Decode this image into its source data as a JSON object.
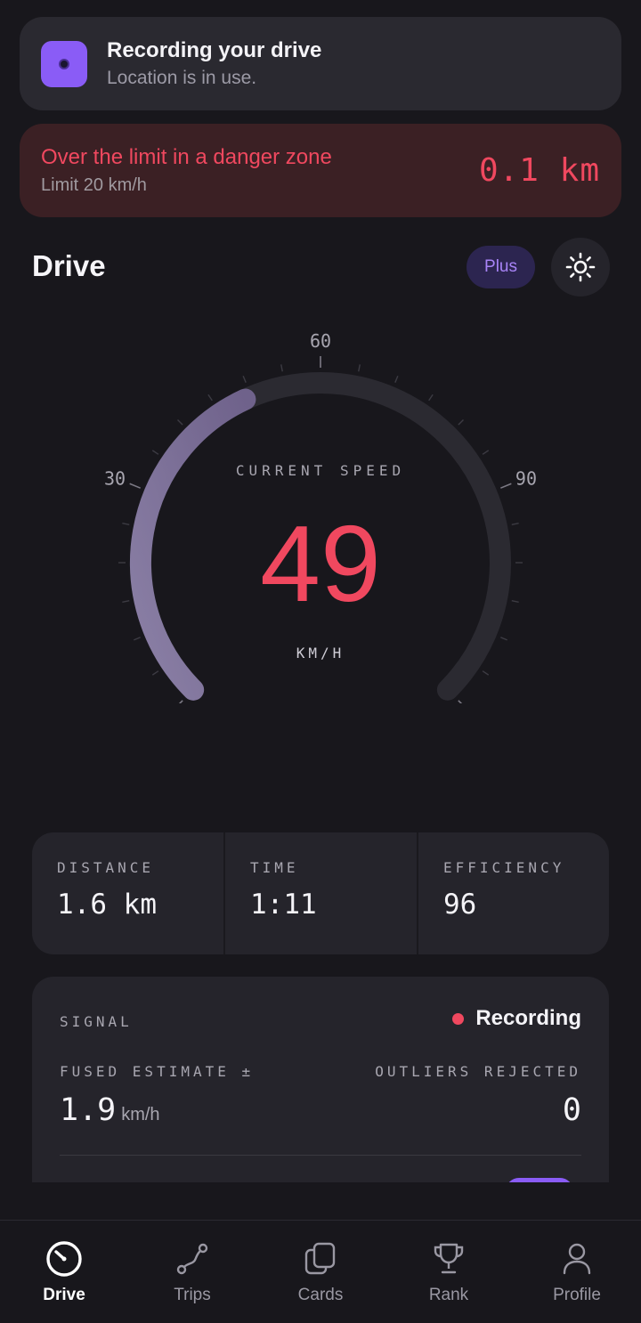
{
  "notification": {
    "title": "Recording your drive",
    "subtitle": "Location is in use.",
    "icon": "record-dot-icon",
    "accent": "#8a5cf6"
  },
  "alert": {
    "title": "Over the limit in a danger zone",
    "subtitle": "Limit 20 km/h",
    "distance": "0.1 km",
    "color": "#f0485f"
  },
  "header": {
    "title": "Drive",
    "plus_label": "Plus",
    "theme_icon": "sun-icon"
  },
  "speedometer": {
    "label": "CURRENT SPEED",
    "value": "49",
    "unit": "KM/H",
    "speed": 49,
    "max": 120,
    "ticks": [
      "0",
      "30",
      "60",
      "90",
      "120"
    ],
    "arc_color": "#76698e",
    "track_color": "#2b2a31"
  },
  "stats": [
    {
      "label": "DISTANCE",
      "value": "1.6 km"
    },
    {
      "label": "TIME",
      "value": "1:11"
    },
    {
      "label": "EFFICIENCY",
      "value": "96"
    }
  ],
  "signal": {
    "label": "SIGNAL",
    "status": "Recording",
    "fused_label": "FUSED ESTIMATE ±",
    "fused_value": "1.9",
    "fused_unit": "km/h",
    "outliers_label": "OUTLIERS REJECTED",
    "outliers_value": "0"
  },
  "nav": [
    {
      "label": "Drive",
      "icon": "speedometer-icon",
      "active": true
    },
    {
      "label": "Trips",
      "icon": "route-icon",
      "active": false
    },
    {
      "label": "Cards",
      "icon": "cards-icon",
      "active": false
    },
    {
      "label": "Rank",
      "icon": "trophy-icon",
      "active": false
    },
    {
      "label": "Profile",
      "icon": "person-icon",
      "active": false
    }
  ]
}
